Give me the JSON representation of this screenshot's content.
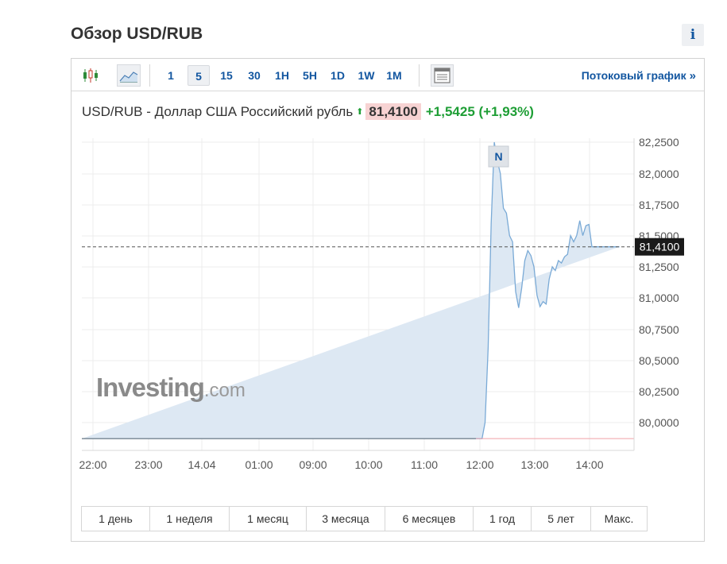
{
  "page": {
    "title": "Обзор USD/RUB",
    "info_label": "i"
  },
  "toolbar": {
    "intervals": [
      "1",
      "5",
      "15",
      "30",
      "1H",
      "5H",
      "1D",
      "1W",
      "1M"
    ],
    "active_interval": "5",
    "stream_label": "Потоковый график",
    "stream_arrow": "»",
    "icons": [
      "candlestick-icon",
      "area-chart-icon",
      "table-icon"
    ]
  },
  "quote": {
    "name": "USD/RUB - Доллар США Российский рубль",
    "arrow": "⬆",
    "price": "81,4100",
    "change": "+1,5425 (+1,93%)",
    "colors": {
      "up": "#1e9e35",
      "price_bg": "#f7d3d3"
    }
  },
  "chart_data": {
    "type": "area",
    "y_ticks": [
      "82,2500",
      "82,0000",
      "81,7500",
      "81,5000",
      "81,2500",
      "81,0000",
      "80,7500",
      "80,5000",
      "80,2500",
      "80,0000"
    ],
    "x_ticks": [
      "22:00",
      "23:00",
      "14.04",
      "01:00",
      "09:00",
      "10:00",
      "11:00",
      "12:00",
      "13:00",
      "14:00"
    ],
    "ylim": [
      79.87,
      82.26
    ],
    "current_value": 81.41,
    "current_label": "81,4100",
    "event_marker": "N",
    "flat_value": 79.87,
    "series_x": [
      0,
      1,
      2,
      3,
      4,
      5,
      6,
      7,
      8,
      9,
      10,
      11,
      12,
      13,
      14,
      15,
      16,
      17,
      18,
      19,
      20,
      21,
      22,
      23,
      24,
      25,
      26,
      27,
      28,
      29,
      30,
      31,
      32,
      33,
      34,
      35,
      36,
      37,
      38,
      39,
      40,
      41,
      42,
      43,
      44,
      45,
      46,
      47,
      48,
      49,
      50,
      51,
      52,
      53,
      54,
      55,
      56,
      57,
      58,
      59,
      60,
      61,
      62,
      63,
      64,
      65,
      66,
      67,
      68,
      69,
      70,
      71,
      72,
      73,
      74,
      75,
      76,
      77,
      78,
      79,
      80,
      81,
      82,
      83,
      84,
      85,
      86,
      87,
      88,
      89,
      90,
      91,
      92,
      93,
      94,
      95,
      96,
      97,
      98,
      99,
      100,
      101,
      102,
      103,
      104,
      105,
      106,
      107,
      108,
      109,
      110,
      111,
      112,
      113,
      114,
      115,
      116,
      117,
      118,
      119,
      120,
      121,
      122,
      123,
      124,
      125,
      126,
      127,
      128,
      129,
      130,
      131,
      132,
      133,
      134,
      135,
      136,
      137,
      138,
      139,
      140,
      141,
      142,
      143,
      144,
      145,
      146,
      147,
      148,
      149,
      150,
      151,
      152,
      153,
      154,
      155,
      156,
      157,
      158,
      159,
      160,
      161,
      162,
      163,
      164,
      165,
      166,
      167,
      168,
      169,
      170,
      171
    ],
    "series_y": [
      79.87,
      79.87,
      79.87,
      79.87,
      79.87,
      79.87,
      79.87,
      79.87,
      79.87,
      79.87,
      79.87,
      79.87,
      79.87,
      79.87,
      79.87,
      79.87,
      79.87,
      79.87,
      79.87,
      79.87,
      79.87,
      79.87,
      79.87,
      79.87,
      79.87,
      79.87,
      79.87,
      79.87,
      79.87,
      79.87,
      79.87,
      79.87,
      79.87,
      79.87,
      79.87,
      79.87,
      79.87,
      79.87,
      79.87,
      79.87,
      79.87,
      79.87,
      79.87,
      79.87,
      79.87,
      79.87,
      79.87,
      79.87,
      79.87,
      79.87,
      79.87,
      79.87,
      79.87,
      79.87,
      79.87,
      79.87,
      79.87,
      79.87,
      79.87,
      79.87,
      79.87,
      79.87,
      79.87,
      79.87,
      79.87,
      79.87,
      79.87,
      79.87,
      79.87,
      79.87,
      79.87,
      79.87,
      79.87,
      79.87,
      79.87,
      79.87,
      79.87,
      79.87,
      79.87,
      79.87,
      79.87,
      79.87,
      79.87,
      79.87,
      79.87,
      79.87,
      79.87,
      79.87,
      79.87,
      79.87,
      79.87,
      79.87,
      79.87,
      79.87,
      79.87,
      79.87,
      79.87,
      79.87,
      79.87,
      79.87,
      79.87,
      79.87,
      79.87,
      79.87,
      79.87,
      79.87,
      79.87,
      79.87,
      79.87,
      79.87,
      79.87,
      79.87,
      79.87,
      79.87,
      79.87,
      79.87,
      79.87,
      79.87,
      79.87,
      79.87,
      79.87,
      79.87,
      79.87,
      80.0,
      80.6,
      81.6,
      82.25,
      82.1,
      82.0,
      81.72,
      81.68,
      81.5,
      81.45,
      81.05,
      80.92,
      81.08,
      81.3,
      81.38,
      81.34,
      81.25,
      81.02,
      80.93,
      80.97,
      80.95,
      81.15,
      81.25,
      81.22,
      81.3,
      81.28,
      81.33,
      81.35,
      81.5,
      81.45,
      81.5,
      81.62,
      81.5,
      81.58,
      81.59,
      81.41,
      81.41,
      81.41,
      81.41,
      81.41,
      81.41,
      81.41,
      81.41,
      81.41,
      81.41
    ]
  },
  "watermark": {
    "brand": "Investing",
    "domain": ".com"
  },
  "ranges": [
    "1 день",
    "1 неделя",
    "1 месяц",
    "3 месяца",
    "6 месяцев",
    "1 год",
    "5 лет",
    "Макс."
  ]
}
